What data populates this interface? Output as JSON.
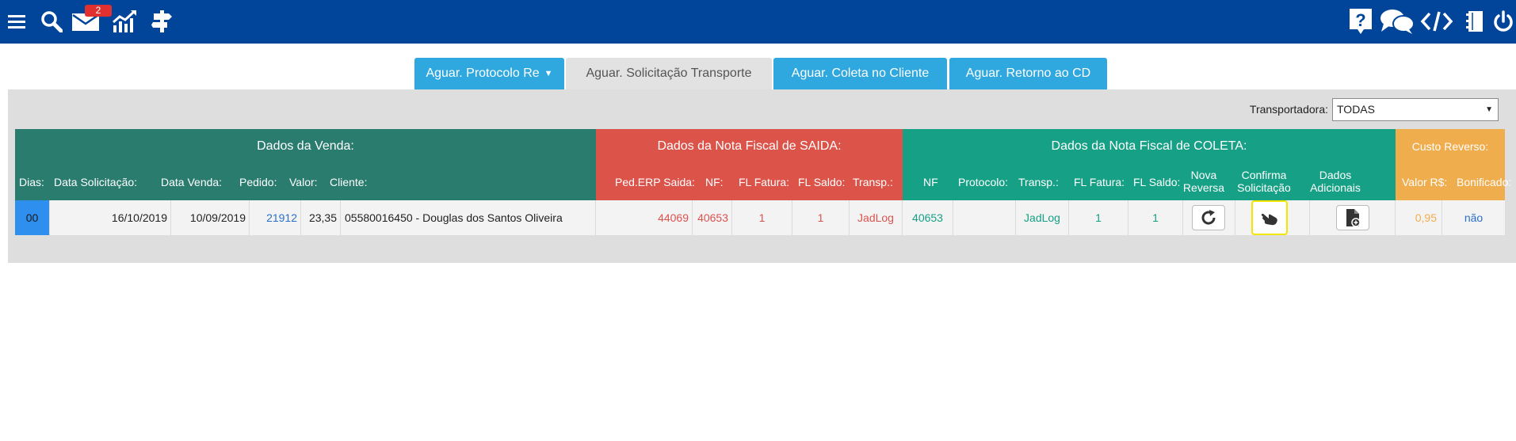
{
  "topbar": {
    "badge_count": "2",
    "colors": {
      "bar": "#004599",
      "badge": "#e03030"
    },
    "icons": [
      "menu-icon",
      "search-icon",
      "mail-icon",
      "chart-icon",
      "signpost-icon",
      "help-icon",
      "chat-icon",
      "code-icon",
      "notebook-icon",
      "power-icon"
    ]
  },
  "tabs": [
    {
      "label": "Aguar. Protocolo Re",
      "has_caret": true,
      "caret": "▼",
      "active": false
    },
    {
      "label": "Aguar. Solicitação Transporte",
      "active": true
    },
    {
      "label": "Aguar. Coleta no Cliente",
      "active": false
    },
    {
      "label": "Aguar. Retorno ao CD",
      "active": false
    }
  ],
  "filter": {
    "label": "Transportadora:",
    "selected": "TODAS",
    "arrow": "▼"
  },
  "groups": {
    "venda": {
      "title": "Dados da Venda:",
      "color": "#2a7c6f"
    },
    "saida": {
      "title": "Dados da Nota Fiscal de SAIDA:",
      "color": "#dc5349"
    },
    "coleta": {
      "title": "Dados da Nota Fiscal de COLETA:",
      "color": "#16a085"
    },
    "custo": {
      "title": "Custo Reverso:",
      "color": "#f0ad4e"
    }
  },
  "columns": {
    "dias": "Dias:",
    "data_solicitacao": "Data Solicitação:",
    "data_venda": "Data Venda:",
    "pedido": "Pedido:",
    "valor": "Valor:",
    "cliente": "Cliente:",
    "ped_erp": "Ped.ERP Saida:",
    "nf": "NF:",
    "fl_fatura": "FL Fatura:",
    "fl_saldo": "FL Saldo:",
    "transp": "Transp.:",
    "nf_coleta": "NF",
    "protocolo": "Protocolo:",
    "transp_coleta": "Transp.:",
    "fl_fatura_coleta": "FL Fatura:",
    "fl_saldo_coleta": "FL Saldo:",
    "nova_reversa_1": "Nova",
    "nova_reversa_2": "Reversa",
    "confirma_1": "Confirma",
    "confirma_2": "Solicitação",
    "dados_ad_1": "Dados",
    "dados_ad_2": "Adicionais",
    "valor_rs": "Valor R$:",
    "bonificado": "Bonificado:"
  },
  "rows": [
    {
      "dias": "00",
      "data_solicitacao": "16/10/2019",
      "data_venda": "10/09/2019",
      "pedido": "21912",
      "valor": "23,35",
      "cliente": "05580016450 - Douglas dos Santos Oliveira",
      "ped_erp": "44069",
      "nf": "40653",
      "fl_fatura": "1",
      "fl_saldo": "1",
      "transp": "JadLog",
      "nf_coleta": "40653",
      "protocolo": "",
      "transp_coleta": "JadLog",
      "fl_fatura_coleta": "1",
      "fl_saldo_coleta": "1",
      "valor_rs": "0,95",
      "bonificado": "não"
    }
  ]
}
